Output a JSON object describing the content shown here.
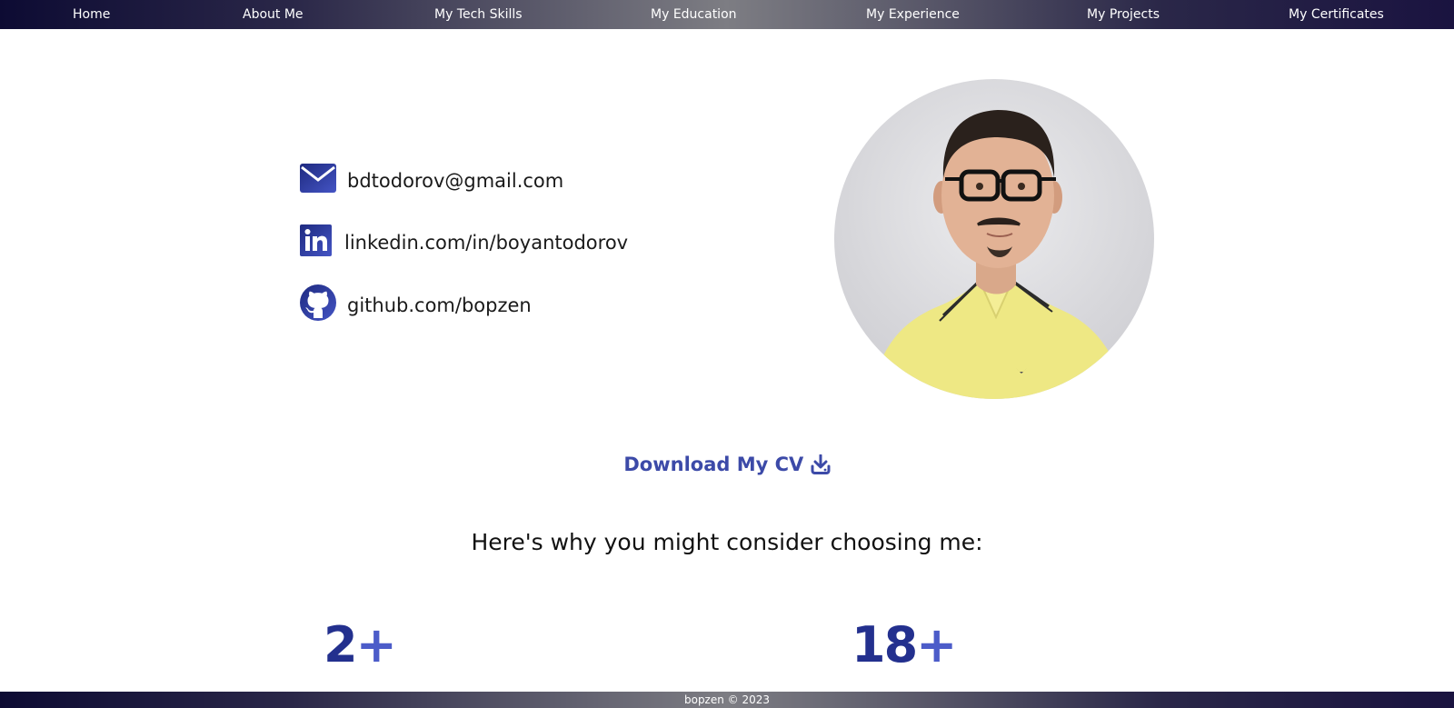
{
  "nav": {
    "items": [
      {
        "label": "Home"
      },
      {
        "label": "About Me"
      },
      {
        "label": "My Tech Skills"
      },
      {
        "label": "My Education"
      },
      {
        "label": "My Experience"
      },
      {
        "label": "My Projects"
      },
      {
        "label": "My Certificates"
      }
    ]
  },
  "contacts": {
    "email": "bdtodorov@gmail.com",
    "linkedin": "linkedin.com/in/boyantodorov",
    "github": "github.com/bopzen"
  },
  "cv": {
    "label": "Download My CV"
  },
  "why": {
    "heading": "Here's why you might consider choosing me:"
  },
  "stats": [
    {
      "number": "2",
      "suffix": "+"
    },
    {
      "number": "18",
      "suffix": "+"
    }
  ],
  "footer": {
    "text": "bopzen © 2023"
  },
  "colors": {
    "accent": "#3c4aa8",
    "stat_number": "#23308e",
    "stat_plus": "#4c5cc9",
    "nav_dark": "#0d0b33"
  }
}
